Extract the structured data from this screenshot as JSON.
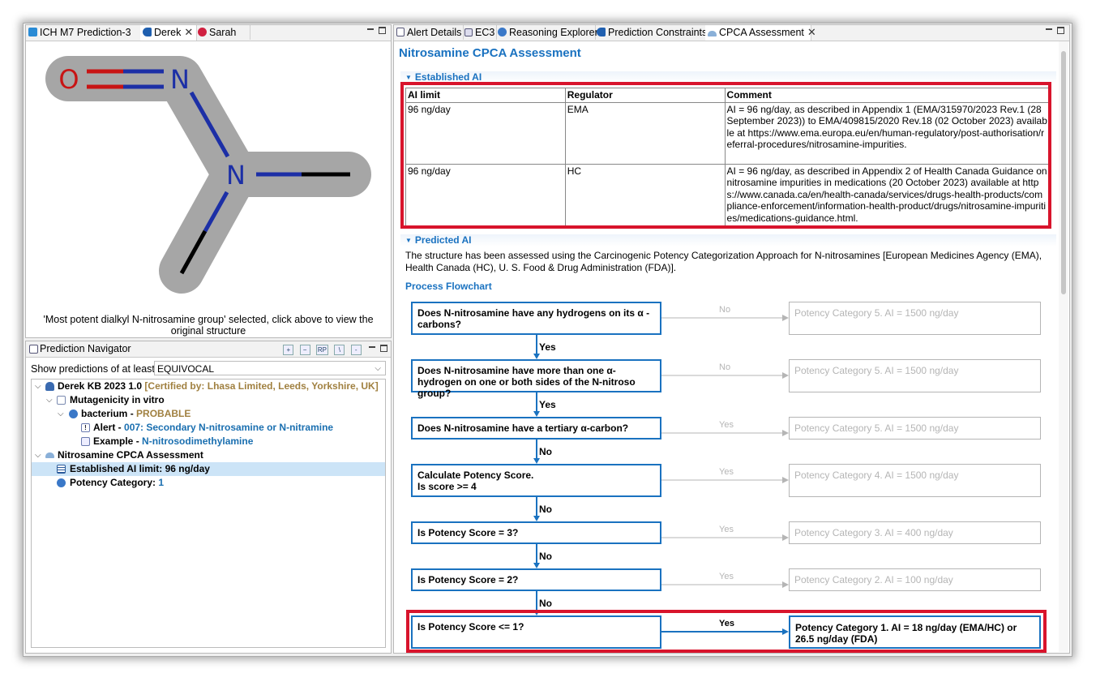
{
  "left_tabs": [
    {
      "label": "ICH M7 Prediction-3"
    },
    {
      "label": "Derek"
    },
    {
      "label": "Sarah"
    }
  ],
  "structure": {
    "atom_o": "O",
    "atom_n1": "N",
    "atom_n2": "N",
    "caption": "'Most potent dialkyl N-nitrosamine group' selected, click above to view the original structure"
  },
  "navigator": {
    "title": "Prediction Navigator",
    "filter_label": "Show predictions of at least:",
    "filter_value": "EQUIVOCAL",
    "tree": {
      "kb_name": "Derek KB 2023 1.0",
      "kb_cert": "[Certified by: Lhasa Limited, Leeds, Yorkshire, UK]",
      "endpoint": "Mutagenicity in vitro",
      "species": "bacterium",
      "species_sep": " - ",
      "species_result": "PROBABLE",
      "alert_label": "Alert",
      "alert_sep": " - ",
      "alert_value": "007: Secondary N-nitrosamine or N-nitramine",
      "example_label": "Example",
      "example_sep": " - ",
      "example_value": "N-nitrosodimethylamine",
      "cpca": "Nitrosamine CPCA Assessment",
      "established": "Established AI limit: 96 ng/day",
      "potency_label": "Potency Category",
      "potency_sep": ": ",
      "potency_value": "1"
    }
  },
  "right_tabs": [
    {
      "label": "Alert Details"
    },
    {
      "label": "EC3"
    },
    {
      "label": "Reasoning Explorer"
    },
    {
      "label": "Prediction Constraints"
    },
    {
      "label": "CPCA Assessment"
    }
  ],
  "cpca": {
    "title": "Nitrosamine CPCA Assessment",
    "established_header": "Established AI",
    "table_headers": [
      "AI limit",
      "Regulator",
      "Comment"
    ],
    "table_rows": [
      {
        "ai": "96 ng/day",
        "regulator": "EMA",
        "comment": "AI = 96 ng/day, as described in Appendix 1 (EMA/315970/2023 Rev.1 (28 September 2023)) to EMA/409815/2020 Rev.18 (02 October 2023) available at https://www.ema.europa.eu/en/human-regulatory/post-authorisation/referral-procedures/nitrosamine-impurities."
      },
      {
        "ai": "96 ng/day",
        "regulator": "HC",
        "comment": "AI = 96 ng/day, as described in Appendix 2 of Health Canada Guidance on nitrosamine impurities in medications (20 October 2023) available at https://www.canada.ca/en/health-canada/services/drugs-health-products/compliance-enforcement/information-health-product/drugs/nitrosamine-impurities/medications-guidance.html."
      }
    ],
    "predicted_header": "Predicted AI",
    "predicted_text": "The structure has been assessed using the Carcinogenic Potency Categorization Approach for N-nitrosamines [European Medicines Agency (EMA), Health Canada (HC), U. S. Food & Drug Administration (FDA)].",
    "flowchart_label": "Process Flowchart",
    "flow": [
      {
        "question": "Does N-nitrosamine have any hydrogens on its α -carbons?",
        "branch": "No",
        "outcome": "Potency Category 5. AI = 1500 ng/day",
        "down": "Yes",
        "active": false
      },
      {
        "question": "Does N-nitrosamine have more than one α-hydrogen on one or both sides of the N-nitroso group?",
        "branch": "No",
        "outcome": "Potency Category 5. AI = 1500 ng/day",
        "down": "Yes",
        "active": false
      },
      {
        "question": "Does N-nitrosamine have a tertiary α-carbon?",
        "branch": "Yes",
        "outcome": "Potency Category 5. AI = 1500 ng/day",
        "down": "No",
        "active": false
      },
      {
        "question": "Calculate Potency Score.\nIs score >= 4",
        "branch": "Yes",
        "outcome": "Potency Category 4. AI = 1500 ng/day",
        "down": "No",
        "active": false
      },
      {
        "question": "Is Potency Score = 3?",
        "branch": "Yes",
        "outcome": "Potency Category 3. AI = 400 ng/day",
        "down": "No",
        "active": false
      },
      {
        "question": "Is Potency Score = 2?",
        "branch": "Yes",
        "outcome": "Potency Category 2. AI = 100 ng/day",
        "down": "No",
        "active": false
      },
      {
        "question": "Is Potency Score <= 1?",
        "branch": "Yes",
        "outcome": "Potency Category 1. AI = 18 ng/day (EMA/HC) or 26.5 ng/day (FDA)",
        "down": "",
        "active": true
      }
    ]
  },
  "colors": {
    "accent": "#1a72c0",
    "highlight_border": "#d8142c",
    "selection": "#cce4f7",
    "structure_highlight": "#a6a6a6",
    "oxygen": "#c81414",
    "nitrogen": "#1c2fa6"
  }
}
